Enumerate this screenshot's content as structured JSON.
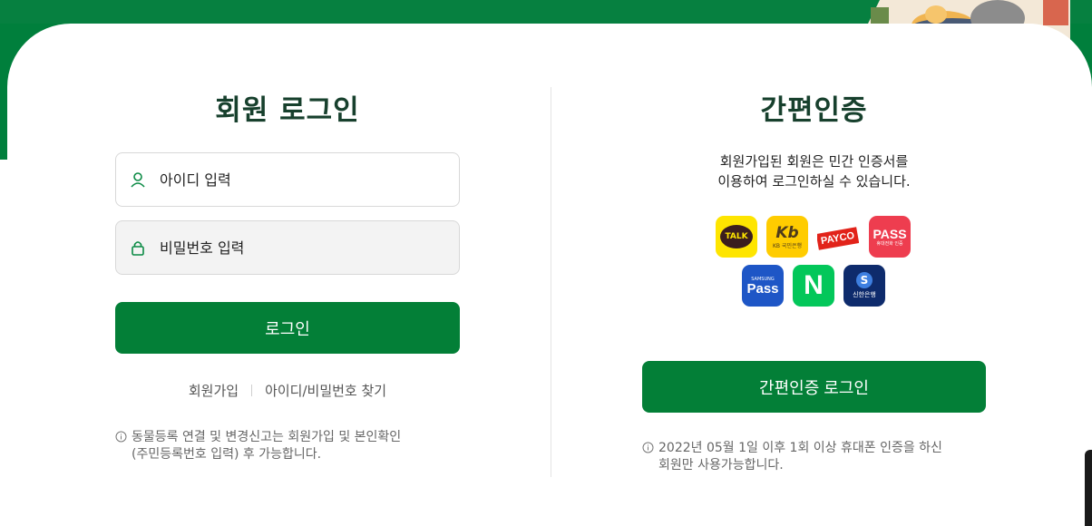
{
  "login": {
    "title": "회원 로그인",
    "id_placeholder": "아이디 입력",
    "pw_placeholder": "비밀번호 입력",
    "button": "로그인",
    "links": [
      "회원가입",
      "아이디/비밀번호 찾기"
    ],
    "note_line1": "동물등록 연결 및 변경신고는 회원가입 및 본인확인",
    "note_line2": "(주민등록번호 입력) 후 가능합니다."
  },
  "easy": {
    "title": "간편인증",
    "desc_line1": "회원가입된 회원은 민간 인증서를",
    "desc_line2": "이용하여 로그인하실 수 있습니다.",
    "providers": {
      "kakao": "TALK",
      "kb_mark": "Kb",
      "kb_sub": "KB 국민은행",
      "payco": "PAYCO",
      "pass": "PASS",
      "pass_sub": "휴대전화 인증",
      "samsung_sub": "SAMSUNG",
      "samsung": "Pass",
      "naver": "N",
      "shinhan_mark": "S",
      "shinhan": "신한은행"
    },
    "button": "간편인증 로그인",
    "note_line1": "2022년 05월 1일 이후 1회 이상 휴대폰 인증을 하신",
    "note_line2": "회원만 사용가능합니다."
  },
  "colors": {
    "brand_green": "#037f37",
    "title_dark": "#17402d"
  },
  "icons": [
    "user-icon",
    "lock-icon",
    "info-icon"
  ]
}
